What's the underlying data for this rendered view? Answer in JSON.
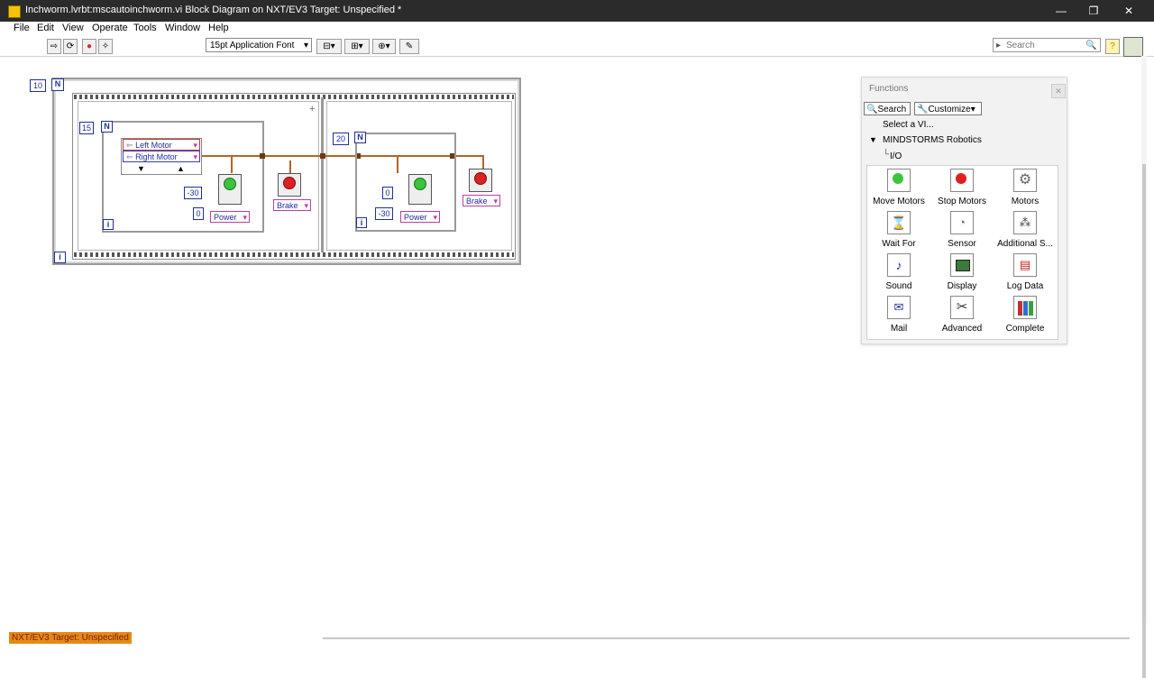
{
  "window": {
    "title": "Inchworm.lvrbt:mscautoinchworm.vi Block Diagram on NXT/EV3 Target: Unspecified *",
    "minimize": "—",
    "restore": "❐",
    "close": "✕"
  },
  "menu": [
    "File",
    "Edit",
    "View",
    "Operate",
    "Tools",
    "Window",
    "Help"
  ],
  "toolbar": {
    "font": "15pt Application Font",
    "search_placeholder": "Search"
  },
  "diagram": {
    "outer_loop_count": "10",
    "loop_n": "N",
    "loop_i": "i",
    "loop1_count": "15",
    "loop2_count": "20",
    "motor_left": "Left Motor",
    "motor_right": "Right Motor",
    "loop1_val_a": "-30",
    "loop1_val_b": "0",
    "loop2_val_a": "0",
    "loop2_val_b": "-30",
    "power_label": "Power",
    "brake_label": "Brake"
  },
  "palette": {
    "title": "Functions",
    "search": "Search",
    "customize": "Customize",
    "select_vi": "Select a VI...",
    "category": "MINDSTORMS Robotics",
    "subcategory": "I/O",
    "items": [
      {
        "label": "Move Motors",
        "icon": "move-motors-icon"
      },
      {
        "label": "Stop Motors",
        "icon": "stop-motors-icon"
      },
      {
        "label": "Motors",
        "icon": "motors-gear-icon"
      },
      {
        "label": "Wait For",
        "icon": "hourglass-icon"
      },
      {
        "label": "Sensor",
        "icon": "sensor-icon"
      },
      {
        "label": "Additional S...",
        "icon": "additional-sensors-icon"
      },
      {
        "label": "Sound",
        "icon": "sound-note-icon"
      },
      {
        "label": "Display",
        "icon": "display-icon"
      },
      {
        "label": "Log Data",
        "icon": "log-data-icon"
      },
      {
        "label": "Mail",
        "icon": "mail-icon"
      },
      {
        "label": "Advanced",
        "icon": "tools-icon"
      },
      {
        "label": "Complete",
        "icon": "books-icon"
      }
    ]
  },
  "status": {
    "target": "NXT/EV3 Target: Unspecified"
  },
  "colors": {
    "wire": "#b0662b",
    "terminal": "#1f2f9a",
    "enum_border": "#c03ca0",
    "status_bg": "#e58a17"
  }
}
